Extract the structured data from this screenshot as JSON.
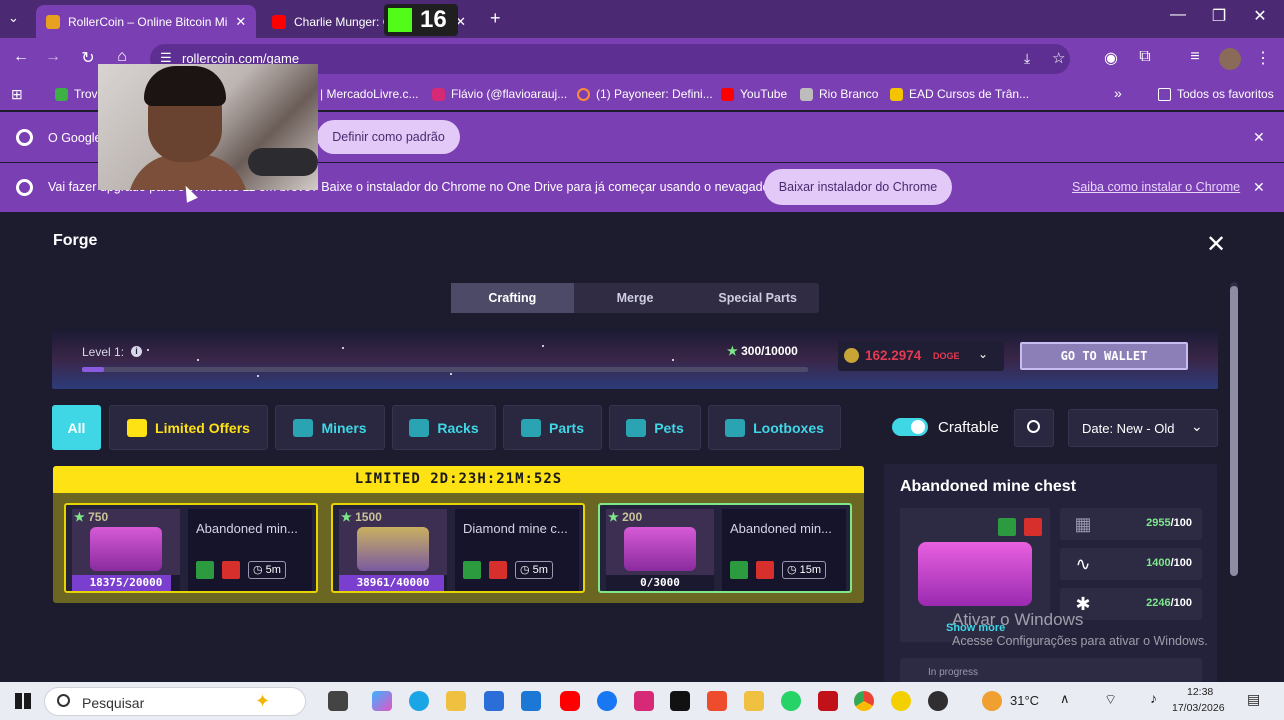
{
  "browser": {
    "tabs": [
      {
        "title": "RollerCoin – Online Bitcoin Mi",
        "close": "✕",
        "color": "#e8a020"
      },
      {
        "title": "Charlie Munger: Co",
        "close": "✕",
        "color": "#ff0000"
      }
    ],
    "new_tab": "+",
    "tab_menu": "⌄",
    "overlay_badge": "16",
    "window_controls": {
      "minimize": "—",
      "restore": "❐",
      "close": "✕"
    },
    "url": "rollercoin.com/game",
    "bookmarks": [
      {
        "label": "Trov",
        "color": "#3cb043"
      },
      {
        "label": "| MercadoLivre.c...",
        "color": "#ffe600"
      },
      {
        "label": "Flávio (@flavioarauj...",
        "color": "#d62976"
      },
      {
        "label": "(1) Payoneer: Defini...",
        "color": "#ff4800"
      },
      {
        "label": "YouTube",
        "color": "#ff0000"
      },
      {
        "label": "Rio Branco",
        "color": "#bdbdbd"
      },
      {
        "label": "EAD Cursos de Trân...",
        "color": "#f5c400"
      }
    ],
    "bookmarks_overflow": "»",
    "all_bookmarks": "Todos os favoritos",
    "infobar1": {
      "text": "O Google",
      "button": "Definir como padrão",
      "close": "✕"
    },
    "infobar2": {
      "text": "Vai fazer upgrade para o Windows 11 em breve? Baixe o instalador do Chrome no One Drive para já começar usando o nevagador.",
      "button": "Baixar instalador do Chrome",
      "link": "Saiba como instalar o Chrome",
      "close": "✕"
    }
  },
  "forge": {
    "title": "Forge",
    "close": "✕",
    "tabs": [
      "Crafting",
      "Merge",
      "Special Parts"
    ],
    "level_label": "Level 1:",
    "level_info": "i",
    "level_progress": 0.03,
    "xp": "300/10000",
    "xp_star": "★",
    "balance": "162.2974",
    "currency": "DOGE",
    "wallet_button": "GO TO WALLET",
    "filters": [
      "All",
      "Limited Offers",
      "Miners",
      "Racks",
      "Parts",
      "Pets",
      "Lootboxes"
    ],
    "craftable_label": "Craftable",
    "craftable_on": true,
    "sort": "Date: New - Old",
    "limited_timer": "LIMITED 2D:23H:21M:52S",
    "cards": [
      {
        "stars": "750",
        "name": "Abandoned min...",
        "progress": "18375/20000",
        "fill": 0.92,
        "time": "5m"
      },
      {
        "stars": "1500",
        "name": "Diamond mine c...",
        "progress": "38961/40000",
        "fill": 0.97,
        "time": "5m"
      },
      {
        "stars": "200",
        "name": "Abandoned min...",
        "progress": "0/3000",
        "fill": 0,
        "time": "15m"
      }
    ],
    "detail": {
      "title": "Abandoned mine chest",
      "show_more": "Show more",
      "stats": [
        {
          "have": "2955",
          "need": "/100"
        },
        {
          "have": "1400",
          "need": "/100"
        },
        {
          "have": "2246",
          "need": "/100"
        }
      ],
      "in_progress": "In progress"
    },
    "windows_watermark": {
      "title": "Ativar o Windows",
      "subtitle": "Acesse Configurações para ativar o Windows."
    }
  },
  "taskbar": {
    "search_placeholder": "Pesquisar",
    "weather": "31°C",
    "time": "12:38",
    "date": "17/03/2026"
  }
}
